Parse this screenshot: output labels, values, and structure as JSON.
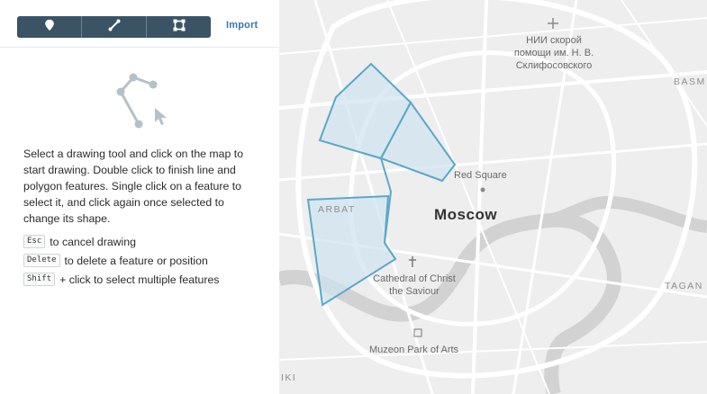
{
  "toolbar": {
    "tools": [
      {
        "icon": "marker-icon",
        "label": "point"
      },
      {
        "icon": "line-icon",
        "label": "line"
      },
      {
        "icon": "polygon-icon",
        "label": "polygon"
      }
    ],
    "import_label": "Import"
  },
  "instructions": "Select a drawing tool and click on the map to start drawing. Double click to finish line and polygon features. Single click on a feature to select it, and click again once selected to change its shape.",
  "shortcuts": [
    {
      "key": "Esc",
      "text": "to cancel drawing"
    },
    {
      "key": "Delete",
      "text": "to delete a feature or position"
    },
    {
      "key": "Shift",
      "text": "+ click to select multiple features"
    }
  ],
  "map": {
    "labels": {
      "hospital": "НИИ скорой\nпомощи им. Н. В.\nСклифосовского",
      "red_square": "Red Square",
      "city": "Moscow",
      "arbat": "ARBAT",
      "cathedral": "Cathedral of Christ\nthe Saviour",
      "muzeon": "Muzeon Park of Arts",
      "basm": "BASM",
      "tagan": "TAGAN",
      "iki": "IKI"
    },
    "colors": {
      "polygon_stroke": "#5aa8c8",
      "polygon_fill": "#cfe4ef",
      "background": "#eeeeee",
      "road": "#ffffff",
      "river": "#d2d2d2"
    }
  }
}
